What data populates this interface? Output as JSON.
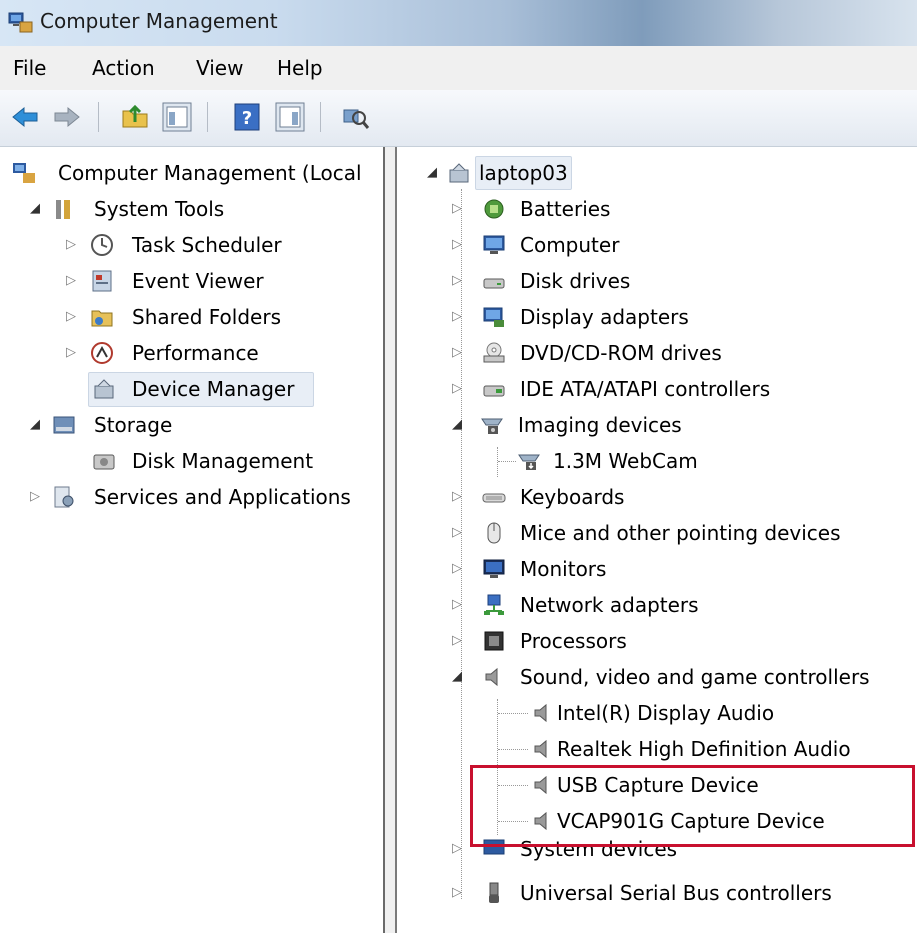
{
  "window": {
    "title": "Computer Management"
  },
  "menu": [
    "File",
    "Action",
    "View",
    "Help"
  ],
  "left_tree": {
    "root": "Computer Management (Local",
    "system_tools": "System Tools",
    "task_scheduler": "Task Scheduler",
    "event_viewer": "Event Viewer",
    "shared_folders": "Shared Folders",
    "performance": "Performance",
    "device_manager": "Device Manager",
    "storage": "Storage",
    "disk_management": "Disk Management",
    "services": "Services and Applications"
  },
  "right_tree": {
    "root": "laptop03",
    "batteries": "Batteries",
    "computer": "Computer",
    "disk_drives": "Disk drives",
    "display_adapters": "Display adapters",
    "dvd": "DVD/CD-ROM drives",
    "ide": "IDE ATA/ATAPI controllers",
    "imaging": "Imaging devices",
    "webcam": "1.3M WebCam",
    "keyboards": "Keyboards",
    "mice": "Mice and other pointing devices",
    "monitors": "Monitors",
    "network": "Network adapters",
    "processors": "Processors",
    "sound": "Sound, video and game controllers",
    "intel_audio": "Intel(R) Display Audio",
    "realtek_audio": "Realtek High Definition Audio",
    "usb_capture": "USB Capture Device",
    "vcap_capture": "VCAP901G Capture Device",
    "system_devices": "System devices",
    "usb_controllers": "Universal Serial Bus controllers"
  },
  "colors": {
    "highlight_box": "#c8102e",
    "selection": "#e8eef6"
  },
  "icons": [
    "back-arrow-icon",
    "forward-arrow-icon",
    "up-folder-icon",
    "show-hide-console-tree-icon",
    "help-icon",
    "show-hide-action-pane-icon",
    "scan-hardware-icon"
  ]
}
